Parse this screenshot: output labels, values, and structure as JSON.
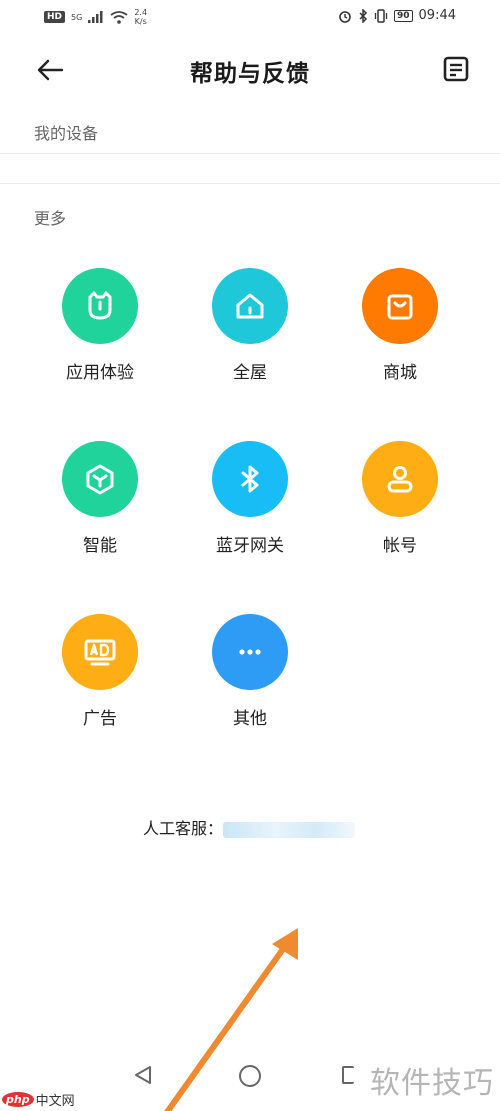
{
  "status_bar": {
    "hd": "HD",
    "network": "5G",
    "speed_value": "2.4",
    "speed_unit": "K/s",
    "battery": "90",
    "time": "09:44"
  },
  "header": {
    "title": "帮助与反馈"
  },
  "sections": {
    "my_devices": "我的设备",
    "more": "更多"
  },
  "items": [
    {
      "label": "应用体验",
      "icon": "mi-logo-icon",
      "color": "#1fd39a"
    },
    {
      "label": "全屋",
      "icon": "home-icon",
      "color": "#1ec8d8"
    },
    {
      "label": "商城",
      "icon": "shopping-bag-icon",
      "color": "#ff7a00"
    },
    {
      "label": "智能",
      "icon": "cube-icon",
      "color": "#1fd39a"
    },
    {
      "label": "蓝牙网关",
      "icon": "bluetooth-icon",
      "color": "#19bdf5"
    },
    {
      "label": "帐号",
      "icon": "user-icon",
      "color": "#ffad14"
    },
    {
      "label": "广告",
      "icon": "ad-icon",
      "color": "#ffad14"
    },
    {
      "label": "其他",
      "icon": "more-dots-icon",
      "color": "#2e9cf5"
    }
  ],
  "service": {
    "label": "人工客服："
  },
  "watermark": {
    "right": "软件技巧",
    "left_logo": "php",
    "left_text": "中文网"
  }
}
